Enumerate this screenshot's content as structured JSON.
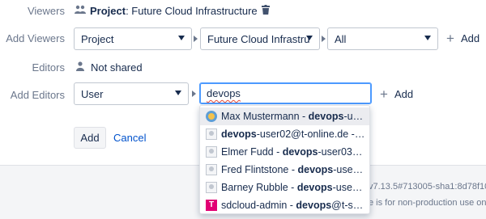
{
  "viewers": {
    "label": "Viewers",
    "project_prefix": "Project",
    "project_suffix": ": Future Cloud Infrastructure"
  },
  "add_viewers": {
    "label": "Add Viewers",
    "type_select": "Project",
    "project_select": "Future Cloud Infrastru",
    "scope_select": "All",
    "add_label": "Add"
  },
  "editors": {
    "label": "Editors",
    "value": "Not shared"
  },
  "add_editors": {
    "label": "Add Editors",
    "type_select": "User",
    "search_value": "devops",
    "add_label": "Add"
  },
  "actions": {
    "add_label": "Add",
    "cancel_label": "Cancel"
  },
  "footer": {
    "version": "v7.13.5#713005-sha1:8d78f10)",
    "note": "e is for non-production use onl"
  },
  "suggestions": [
    {
      "pre": "Max Mustermann - ",
      "bold": "devops",
      "post": "-use...",
      "avatar": "face-icon"
    },
    {
      "pre": "",
      "bold": "devops",
      "post": "-user02@t-online.de - d...",
      "avatar": "default-avatar-icon"
    },
    {
      "pre": "Elmer Fudd - ",
      "bold": "devops",
      "post": "-user03@t...",
      "avatar": "default-avatar-icon"
    },
    {
      "pre": "Fred Flintstone - ",
      "bold": "devops",
      "post": "-user0...",
      "avatar": "default-avatar-icon"
    },
    {
      "pre": "Barney Rubble - ",
      "bold": "devops",
      "post": "-user05...",
      "avatar": "default-avatar-icon"
    },
    {
      "pre": "sdcloud-admin - ",
      "bold": "devops",
      "post": "@t-sys...",
      "avatar": "t-brand-icon"
    }
  ],
  "colors": {
    "link": "#0052cc",
    "focus": "#4c9aff",
    "brand": "#e20074"
  }
}
